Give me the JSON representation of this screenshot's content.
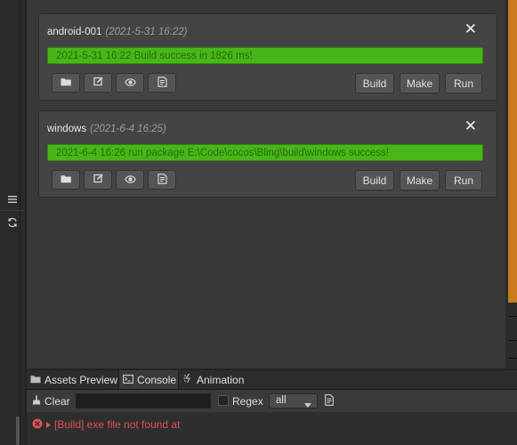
{
  "cards": [
    {
      "title": "android-001",
      "time": "(2021-5-31 16:22)",
      "status": "2021-5-31 16:22 Build success in 1826 ms!",
      "buttons": [
        "Build",
        "Make",
        "Run"
      ]
    },
    {
      "title": "windows",
      "time": "(2021-6-4 16:25)",
      "status": "2021-6-4 16:26 run package E:\\Code\\cocos\\Bling\\build\\windows success!",
      "buttons": [
        "Build",
        "Make",
        "Run"
      ]
    }
  ],
  "icons": {
    "card_close": "close-icon",
    "card_tools": [
      "folder-icon",
      "edit-icon",
      "eye-icon",
      "log-icon"
    ],
    "side": [
      "menu-icon",
      "refresh-icon"
    ]
  },
  "tabs": [
    {
      "label": "Assets Preview",
      "icon": "folder-icon"
    },
    {
      "label": "Console",
      "icon": "console-icon"
    },
    {
      "label": "Animation",
      "icon": "animation-icon"
    }
  ],
  "active_tab": "Console",
  "toolbar": {
    "clear_label": "Clear",
    "search_value": "",
    "regex_label": "Regex",
    "regex_checked": false,
    "filter_selected": "all"
  },
  "console": {
    "messages": [
      {
        "level": "error",
        "text": "[Build] exe file not found at"
      }
    ]
  },
  "colors": {
    "success_bar": "#47b619",
    "success_text": "#2a6a08",
    "error": "#e05050",
    "panel": "#383838",
    "card": "#444444"
  }
}
